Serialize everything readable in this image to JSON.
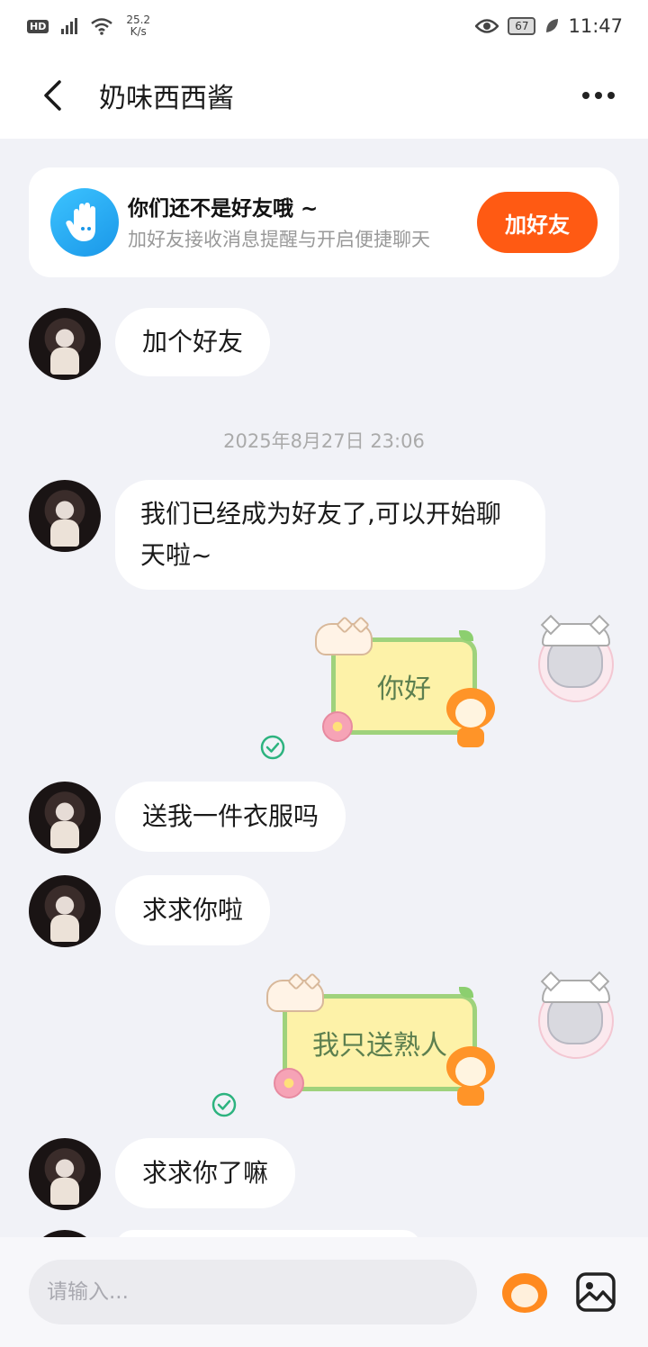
{
  "status_bar": {
    "hd": "HD",
    "speed_value": "25.2",
    "speed_unit": "K/s",
    "battery": "67",
    "time": "11:47"
  },
  "header": {
    "title": "奶味西西酱"
  },
  "friend_banner": {
    "title": "你们还不是好友哦 ~",
    "subtitle": "加好友接收消息提醒与开启便捷聊天",
    "button": "加好友"
  },
  "messages": {
    "m1": "加个好友",
    "timestamp": "2025年8月27日 23:06",
    "m2": "我们已经成为好友了,可以开始聊天啦~",
    "m3": "你好",
    "m4": "送我一件衣服吗",
    "m5": "求求你啦",
    "m6": "我只送熟人",
    "m7": "求求你了嘛"
  },
  "input": {
    "placeholder": "请输入..."
  },
  "colors": {
    "accent": "#ff5a13",
    "bubble_outgoing": "#fdf2a8",
    "bubble_border": "#9fd27c",
    "check": "#2db37f"
  }
}
